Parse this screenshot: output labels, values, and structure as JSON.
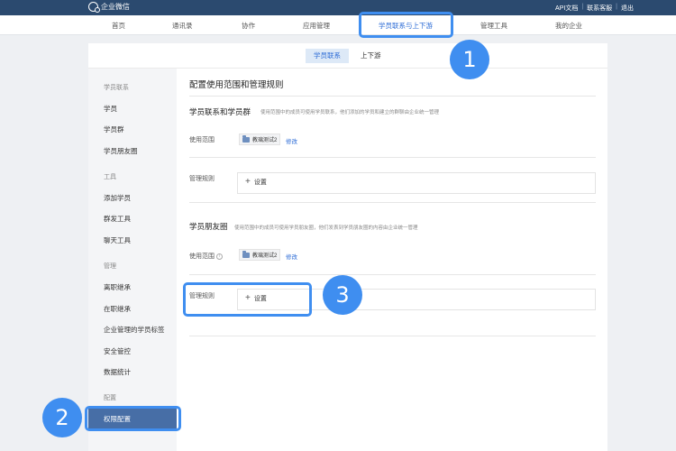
{
  "topbar": {
    "brand": "企业微信",
    "links": [
      "API文档",
      "联系客服",
      "退出"
    ]
  },
  "nav": {
    "items": [
      "首页",
      "通讯录",
      "协作",
      "应用管理",
      "学员联系与上下游",
      "管理工具",
      "我的企业"
    ]
  },
  "subtabs": [
    "学员联系",
    "上下游"
  ],
  "sidebar": {
    "groups": [
      {
        "title": "学员联系",
        "items": [
          "学员",
          "学员群",
          "学员朋友圈"
        ]
      },
      {
        "title": "工具",
        "items": [
          "添加学员",
          "群发工具",
          "聊天工具"
        ]
      },
      {
        "title": "管理",
        "items": [
          "离职继承",
          "在职继承",
          "企业管理的学员标签",
          "安全管控",
          "数据统计"
        ]
      },
      {
        "title": "配置",
        "items": [
          "权限配置"
        ]
      }
    ]
  },
  "main": {
    "title": "配置使用范围和管理规则",
    "sections": [
      {
        "title": "学员联系和学员群",
        "desc": "使用范围中的成员可使用学员联系，他们添加的学员和建立的群聊由企业统一管理",
        "scope_label": "使用范围",
        "scope_tag": "教璃测试2",
        "edit": "修改",
        "rules_label": "管理规则",
        "set_btn": "设置"
      },
      {
        "title": "学员朋友圈",
        "desc": "使用范围中的成员可使用学员朋友圈，他们发表到学员朋友圈的内容由企业统一管理",
        "scope_label": "使用范围",
        "scope_tag": "教璃测试2",
        "edit": "修改",
        "rules_label": "管理规则",
        "set_btn": "设置"
      }
    ]
  },
  "callouts": [
    "1",
    "2",
    "3"
  ],
  "colors": {
    "accent": "#3f8ef0",
    "topbar": "#2b4a6f",
    "sidebar_active": "#476ea6",
    "link": "#2b6bd6"
  }
}
